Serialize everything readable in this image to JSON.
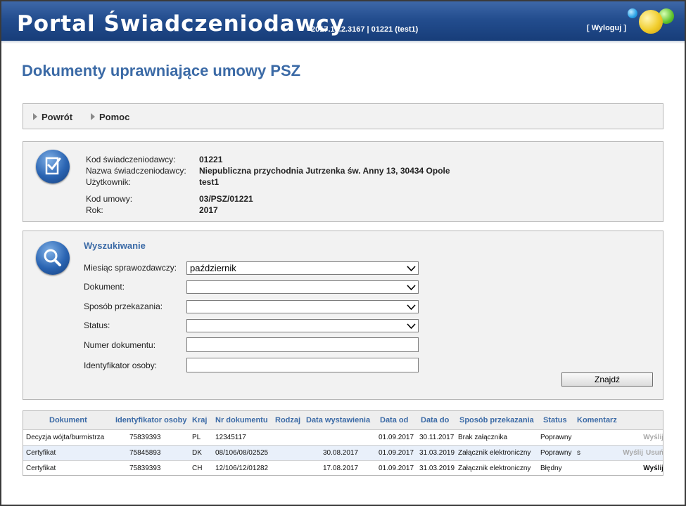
{
  "header": {
    "title": "Portal Świadczeniodawcy",
    "version": "2017.10.2.3167 | 01221 (test1)",
    "logout": "[ Wyloguj ]"
  },
  "page_title": "Dokumenty uprawniające umowy PSZ",
  "toolbar": {
    "back": "Powrót",
    "help": "Pomoc"
  },
  "info": {
    "rows": [
      {
        "label": "Kod świadczeniodawcy:",
        "value": "01221"
      },
      {
        "label": "Nazwa świadczeniodawcy:",
        "value": "Niepubliczna przychodnia Jutrzenka św. Anny 13, 30434 Opole"
      },
      {
        "label": "Użytkownik:",
        "value": "test1"
      },
      {
        "label": "Kod umowy:",
        "value": "03/PSZ/01221"
      },
      {
        "label": "Rok:",
        "value": "2017"
      }
    ]
  },
  "search": {
    "title": "Wyszukiwanie",
    "fields": {
      "month": {
        "label": "Miesiąc sprawozdawczy:",
        "value": "październik"
      },
      "document": {
        "label": "Dokument:",
        "value": ""
      },
      "method": {
        "label": "Sposób przekazania:",
        "value": ""
      },
      "status": {
        "label": "Status:",
        "value": ""
      },
      "doc_number": {
        "label": "Numer dokumentu:",
        "value": ""
      },
      "person_id": {
        "label": "Identyfikator osoby:",
        "value": ""
      }
    },
    "find_button": "Znajdź"
  },
  "table": {
    "columns": [
      "Dokument",
      "Identyfikator osoby",
      "Kraj",
      "Nr dokumentu",
      "Rodzaj",
      "Data wystawienia",
      "Data od",
      "Data do",
      "Sposób przekazania",
      "Status",
      "Komentarz"
    ],
    "rows": [
      {
        "doc": "Decyzja wójta/burmistrza",
        "id": "75839393",
        "country": "PL",
        "number": "12345117",
        "type": "",
        "issued": "",
        "from": "01.09.2017",
        "to": "30.11.2017",
        "method": "Brak załącznika",
        "status": "Poprawny",
        "comment": "",
        "send": "Wyślij",
        "delete": ""
      },
      {
        "doc": "Certyfikat",
        "id": "75845893",
        "country": "DK",
        "number": "08/106/08/02525",
        "type": "",
        "issued": "30.08.2017",
        "from": "01.09.2017",
        "to": "31.03.2019",
        "method": "Załącznik elektroniczny",
        "status": "Poprawny",
        "comment": "s",
        "send": "Wyślij",
        "delete": "Usuń"
      },
      {
        "doc": "Certyfikat",
        "id": "75839393",
        "country": "CH",
        "number": "12/106/12/01282",
        "type": "",
        "issued": "17.08.2017",
        "from": "01.09.2017",
        "to": "31.03.2019",
        "method": "Załącznik elektroniczny",
        "status": "Błędny",
        "comment": "",
        "send": "Wyślij",
        "delete": ""
      }
    ]
  }
}
